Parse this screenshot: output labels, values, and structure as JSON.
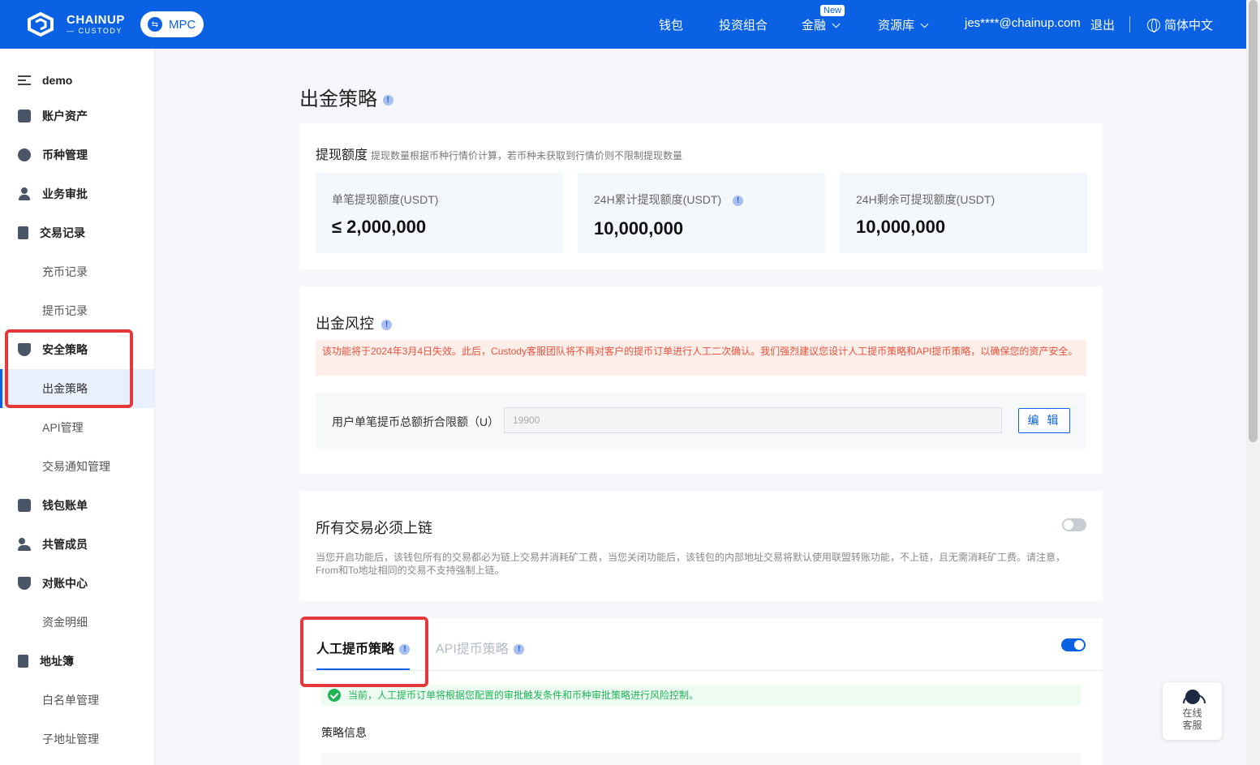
{
  "header": {
    "logo_line1": "CHAINUP",
    "logo_line2": "— CUSTODY",
    "mpc_label": "MPC",
    "nav": {
      "wallet": "钱包",
      "portfolio": "投资组合",
      "finance": "金融",
      "finance_badge": "New",
      "resources": "资源库",
      "email": "jes****@chainup.com",
      "logout": "退出",
      "language": "简体中文"
    },
    "colors": {
      "brand": "#0a61e3"
    }
  },
  "sidebar": {
    "workspace": "demo",
    "items": [
      {
        "label": "账户资产",
        "icon": "wallet-icon"
      },
      {
        "label": "币种管理",
        "icon": "coin-icon"
      },
      {
        "label": "业务审批",
        "icon": "user-icon"
      },
      {
        "label": "交易记录",
        "icon": "document-icon"
      },
      {
        "label": "充币记录"
      },
      {
        "label": "提币记录"
      },
      {
        "label": "安全策略",
        "icon": "shield-icon"
      },
      {
        "label": "出金策略",
        "active": true
      },
      {
        "label": "API管理"
      },
      {
        "label": "交易通知管理"
      },
      {
        "label": "钱包账单",
        "icon": "bill-icon"
      },
      {
        "label": "共管成员",
        "icon": "group-icon"
      },
      {
        "label": "对账中心",
        "icon": "shield-check-icon"
      },
      {
        "label": "资金明细"
      },
      {
        "label": "地址簿",
        "icon": "book-icon"
      },
      {
        "label": "白名单管理"
      },
      {
        "label": "子地址管理"
      }
    ]
  },
  "main": {
    "title": "出金策略",
    "limits": {
      "heading": "提现额度",
      "subheading": "提现数量根据币种行情价计算，若币种未获取到行情价则不限制提现数量",
      "stats": [
        {
          "label": "单笔提现额度(USDT)",
          "value": "≤ 2,000,000"
        },
        {
          "label": "24H累计提现额度(USDT)",
          "value": "10,000,000"
        },
        {
          "label": "24H剩余可提现额度(USDT)",
          "value": "10,000,000"
        }
      ]
    },
    "risk": {
      "heading": "出金风控",
      "alert": "该功能将于2024年3月4日失效。此后，Custody客服团队将不再对客户的提币订单进行人工二次确认。我们强烈建议您设计人工提币策略和API提币策略，以确保您的资产安全。",
      "field_label": "用户单笔提币总额折合限额（U）",
      "field_value": "19900",
      "edit_button": "编 辑"
    },
    "onchain": {
      "heading": "所有交易必须上链",
      "enabled": false,
      "description": "当您开启功能后，该钱包所有的交易都必为链上交易并消耗矿工费，当您关闭功能后，该钱包的内部地址交易将默认使用联盟转账功能，不上链，且无需消耗矿工费。请注意，From和To地址相同的交易不支持强制上链。"
    },
    "strategy": {
      "tabs": [
        "人工提币策略",
        "API提币策略"
      ],
      "active_tab": 0,
      "enabled": true,
      "notice": "当前，人工提币订单将根据您配置的审批触发条件和币种审批策略进行风险控制。",
      "info_label": "策略信息"
    }
  },
  "support": {
    "line1": "在线",
    "line2": "客服"
  }
}
